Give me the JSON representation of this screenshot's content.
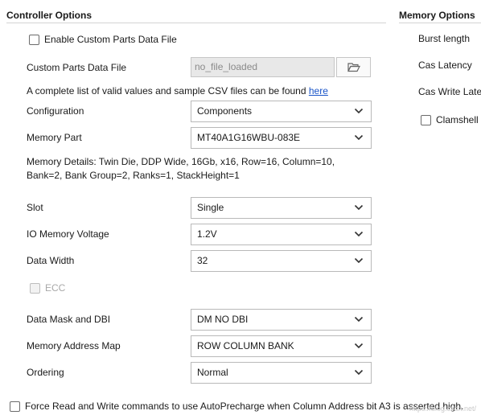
{
  "controller": {
    "title": "Controller Options",
    "enable_custom_label": "Enable Custom Parts Data File",
    "custom_parts_label": "Custom Parts Data File",
    "custom_parts_value": "no_file_loaded",
    "info_text": "A complete list of valid values and sample CSV files can be found ",
    "info_link": "here",
    "configuration": {
      "label": "Configuration",
      "value": "Components"
    },
    "memory_part": {
      "label": "Memory Part",
      "value": "MT40A1G16WBU-083E"
    },
    "memory_details_line1": "Memory Details: Twin Die, DDP Wide, 16Gb, x16, Row=16, Column=10,",
    "memory_details_line2": "Bank=2, Bank Group=2, Ranks=1, StackHeight=1",
    "slot": {
      "label": "Slot",
      "value": "Single"
    },
    "io_voltage": {
      "label": "IO Memory Voltage",
      "value": "1.2V"
    },
    "data_width": {
      "label": "Data Width",
      "value": "32"
    },
    "ecc_label": "ECC",
    "data_mask": {
      "label": "Data Mask and DBI",
      "value": "DM NO DBI"
    },
    "address_map": {
      "label": "Memory Address Map",
      "value": "ROW COLUMN BANK"
    },
    "ordering": {
      "label": "Ordering",
      "value": "Normal"
    },
    "force_read_label": "Force Read and Write commands to use AutoPrecharge when Column Address bit A3 is asserted high."
  },
  "memory": {
    "title": "Memory Options",
    "burst_length_label": "Burst length",
    "cas_latency_label": "Cas Latency",
    "cas_write_latency_label": "Cas Write Late",
    "clamshell_label": "Clamshell"
  },
  "watermark": "https://blog.csdn.net/"
}
